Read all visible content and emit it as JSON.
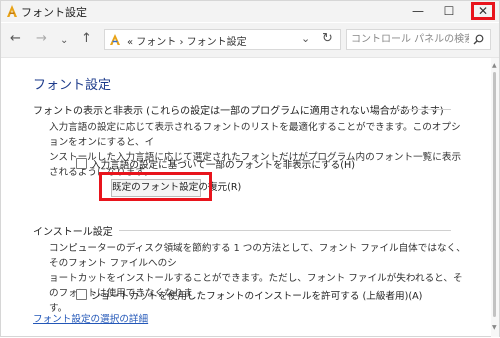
{
  "window": {
    "title": "フォント設定",
    "minimize_glyph": "—",
    "maximize_glyph": "☐",
    "close_glyph": "✕"
  },
  "nav": {
    "back_glyph": "←",
    "forward_glyph": "→",
    "recent_glyph": "⌄",
    "up_glyph": "↑",
    "breadcrumb": "«  フォント  ›  フォント設定",
    "dropdown_glyph": "⌄",
    "refresh_glyph": "↻",
    "search_placeholder": "コントロール パネルの検索"
  },
  "main": {
    "page_title": "フォント設定",
    "show_hide": {
      "heading": "フォントの表示と非表示 (これらの設定は一部のプログラムに適用されない場合があります)",
      "description_line1": "入力言語の設定に応じて表示されるフォントのリストを最適化することができます。このオプションをオンにすると、イ",
      "description_line2": "ンストールした入力言語に応じて選定されたフォントだけがプログラム内のフォント一覧に表示されるようになります。",
      "checkbox_label": "入力言語の設定に基づいて一部のフォントを非表示にする(H)",
      "checkbox_checked": false,
      "restore_button": "既定のフォント設定の復元(R)"
    },
    "install": {
      "heading": "インストール設定",
      "description_line1": "コンピューターのディスク領域を節約する 1 つの方法として、フォント ファイル自体ではなく、そのフォント ファイルへのシ",
      "description_line2": "ョートカットをインストールすることができます。ただし、フォント ファイルが失われると、そのフォントは使用できなくなりま",
      "description_line3": "す。",
      "checkbox_label": "ショートカットを使用したフォントのインストールを許可する (上級者用)(A)",
      "checkbox_checked": false
    },
    "help_link": "フォント設定の選択の詳細"
  },
  "colors": {
    "highlight": "#e8141c",
    "title_blue": "#1e3c8c",
    "link_blue": "#2357b8"
  },
  "icons": {
    "app": "fonts-folder-icon",
    "search": "magnifier-icon"
  }
}
